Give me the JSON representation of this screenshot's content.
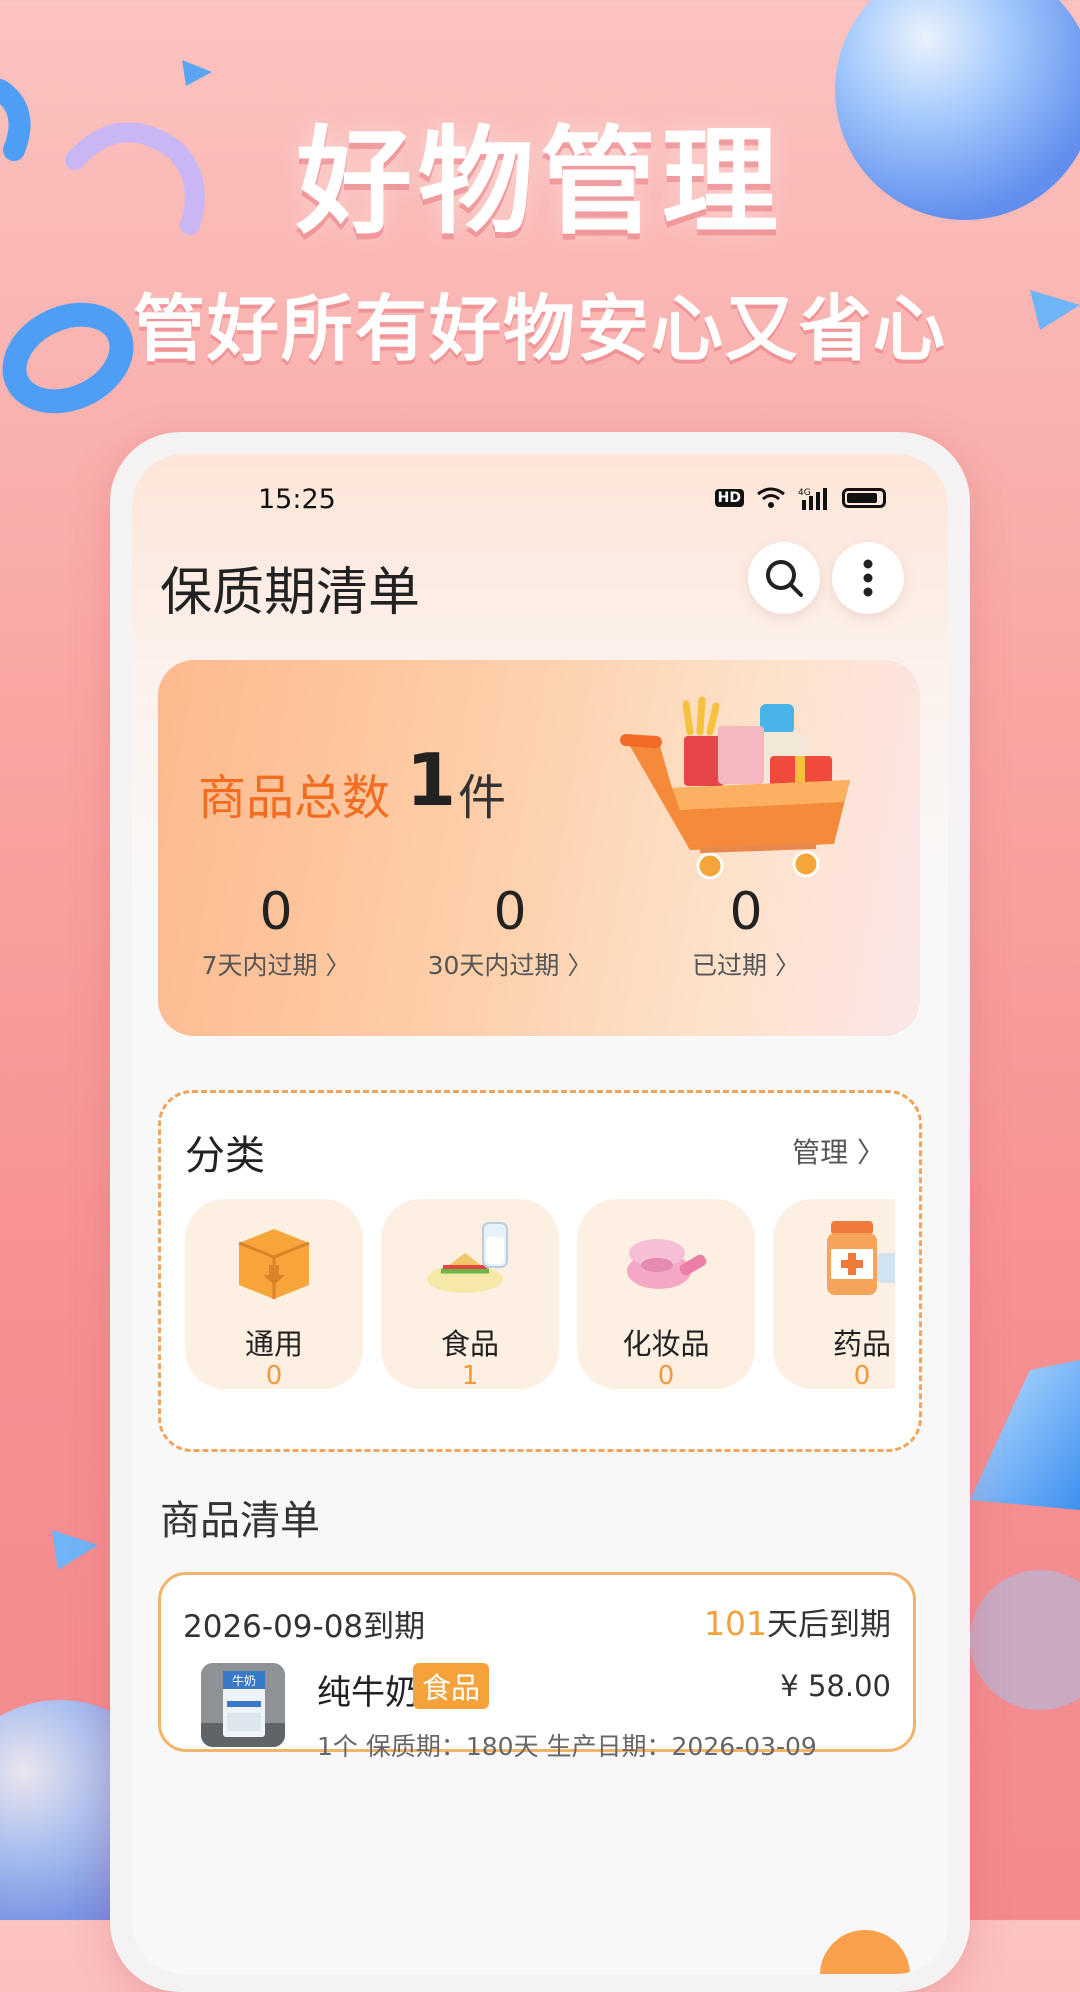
{
  "hero": {
    "title": "好物管理",
    "subtitle": "管好所有好物安心又省心"
  },
  "status_bar": {
    "time": "15:25",
    "hd": "HD",
    "network": "4G"
  },
  "header": {
    "title": "保质期清单",
    "search_icon": "search-icon",
    "more_icon": "more-vertical-icon"
  },
  "summary": {
    "label": "商品总数",
    "total": "1",
    "unit": "件",
    "stats": [
      {
        "value": "0",
        "label": "7天内过期 〉"
      },
      {
        "value": "0",
        "label": "30天内过期 〉"
      },
      {
        "value": "0",
        "label": "已过期 〉"
      }
    ]
  },
  "categories": {
    "title": "分类",
    "manage": "管理 〉",
    "items": [
      {
        "name": "通用",
        "count": "0",
        "icon": "box-icon"
      },
      {
        "name": "食品",
        "count": "1",
        "icon": "food-icon"
      },
      {
        "name": "化妆品",
        "count": "0",
        "icon": "cosmetics-icon"
      },
      {
        "name": "药品",
        "count": "0",
        "icon": "medicine-icon"
      }
    ]
  },
  "list": {
    "title": "商品清单",
    "items": [
      {
        "expire_date": "2026-09-08到期",
        "days_num": "101",
        "days_text": "天后到期",
        "name": "纯牛奶",
        "tag": "食品",
        "price": "¥ 58.00",
        "meta": "1个  保质期：180天  生产日期：2026-03-09",
        "thumb_text": "牛奶"
      }
    ]
  },
  "colors": {
    "accent": "#f26d1f",
    "tag": "#f5a23a",
    "card_border": "#f2b46a"
  }
}
